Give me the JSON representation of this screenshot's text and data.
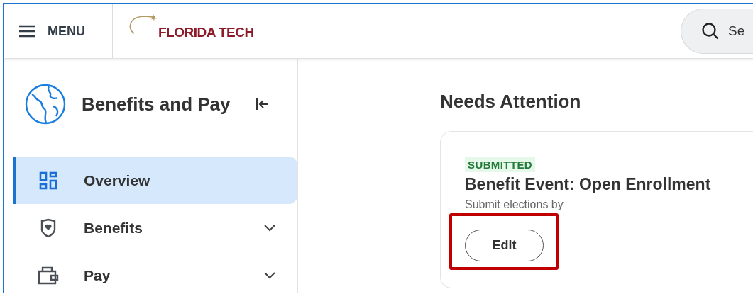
{
  "header": {
    "menu_label": "MENU",
    "logo_text": "FLORIDA TECH",
    "search": {
      "placeholder": "Se"
    }
  },
  "sidebar": {
    "title": "Benefits and Pay",
    "items": [
      {
        "label": "Overview",
        "kind": "grid",
        "selected": true,
        "expandable": false
      },
      {
        "label": "Benefits",
        "kind": "shield",
        "selected": false,
        "expandable": true
      },
      {
        "label": "Pay",
        "kind": "wallet",
        "selected": false,
        "expandable": true
      }
    ]
  },
  "main": {
    "heading": "Needs Attention",
    "card": {
      "status": "SUBMITTED",
      "title": "Benefit Event: Open Enrollment",
      "subtitle": "Submit elections by",
      "button": {
        "label": "Edit",
        "highlighted": true
      }
    }
  }
}
